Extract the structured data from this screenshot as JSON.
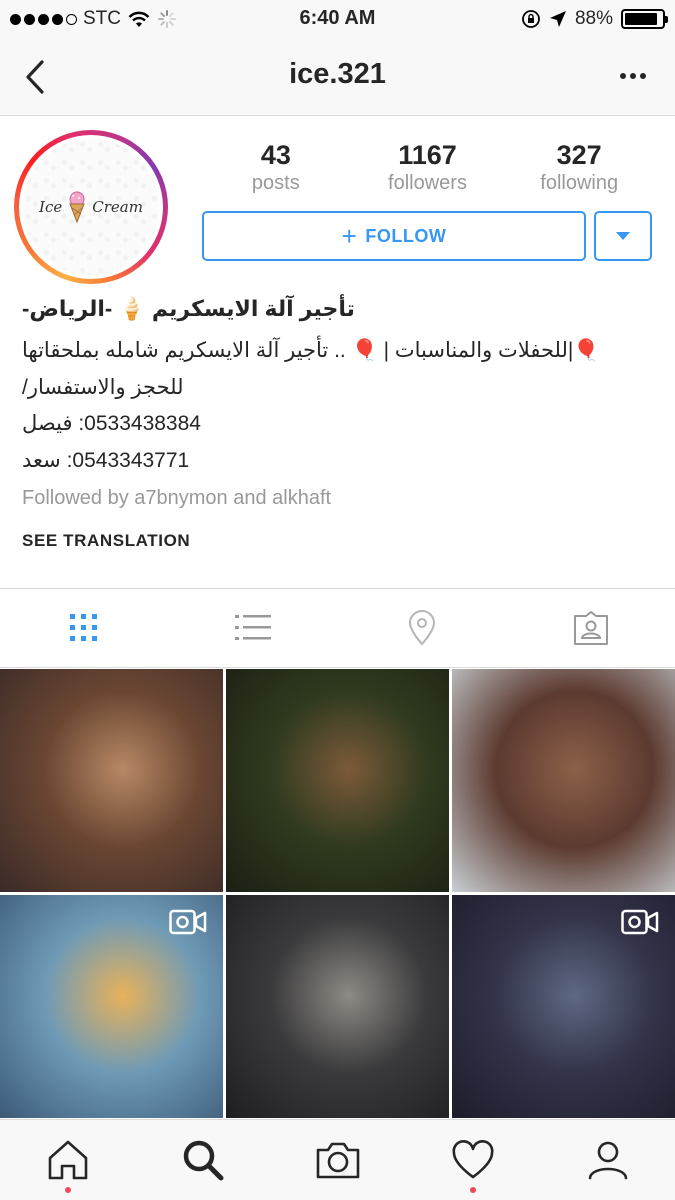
{
  "status_bar": {
    "carrier": "STC",
    "time": "6:40 AM",
    "battery_pct": "88%",
    "battery_level": 0.88
  },
  "nav": {
    "title": "ice.321",
    "back_icon": "chevron-left-icon",
    "more_icon": "more-horizontal-icon"
  },
  "profile": {
    "avatar_text_left": "Ice",
    "avatar_text_right": "Cream",
    "stats": [
      {
        "value": "43",
        "label": "posts"
      },
      {
        "value": "1167",
        "label": "followers"
      },
      {
        "value": "327",
        "label": "following"
      }
    ],
    "follow_label": "FOLLOW",
    "follow_icon": "plus-icon",
    "dropdown_icon": "caret-down-icon"
  },
  "bio": {
    "name": "تأجير آلة الايسكريم 🍦 -الرياض-",
    "line1": "🎈|للحفلات والمناسبات | 🎈 .. تأجير آلة الايسكريم شامله بملحقاتها",
    "line2": "للحجز والاستفسار/",
    "line3": "0533438384: فيصل",
    "line4": "0543343771: سعد",
    "followed_by": "Followed by a7bnymon and alkhaft",
    "see_translation": "SEE TRANSLATION"
  },
  "tabs": [
    {
      "name": "grid-view-icon",
      "active": true
    },
    {
      "name": "list-view-icon",
      "active": false
    },
    {
      "name": "location-pin-icon",
      "active": false
    },
    {
      "name": "tagged-photos-icon",
      "active": false
    }
  ],
  "posts": [
    {
      "label": "post-1",
      "colors": [
        "#6a4632",
        "#b88865",
        "#3a2a28"
      ],
      "video": false
    },
    {
      "label": "post-2",
      "colors": [
        "#2f3a1e",
        "#7c5a3a",
        "#1b1f14"
      ],
      "video": false
    },
    {
      "label": "post-3",
      "colors": [
        "#5c3a30",
        "#8c6048",
        "#c9d0d4"
      ],
      "video": false
    },
    {
      "label": "post-4",
      "colors": [
        "#6e9ab6",
        "#e8b25a",
        "#3c5a78"
      ],
      "video": true
    },
    {
      "label": "post-5",
      "colors": [
        "#3a3a3c",
        "#8e8a84",
        "#1e1e20"
      ],
      "video": false
    },
    {
      "label": "post-6",
      "colors": [
        "#33344a",
        "#5e6884",
        "#1c1c2a"
      ],
      "video": true
    }
  ],
  "bottom_bar": [
    {
      "name": "home-icon",
      "dot": true
    },
    {
      "name": "search-icon",
      "dot": false
    },
    {
      "name": "camera-icon",
      "dot": false
    },
    {
      "name": "heart-icon",
      "dot": true
    },
    {
      "name": "profile-icon",
      "dot": false
    }
  ],
  "colors": {
    "accent": "#3897f0",
    "notification": "#ed4956",
    "muted": "#999999"
  }
}
